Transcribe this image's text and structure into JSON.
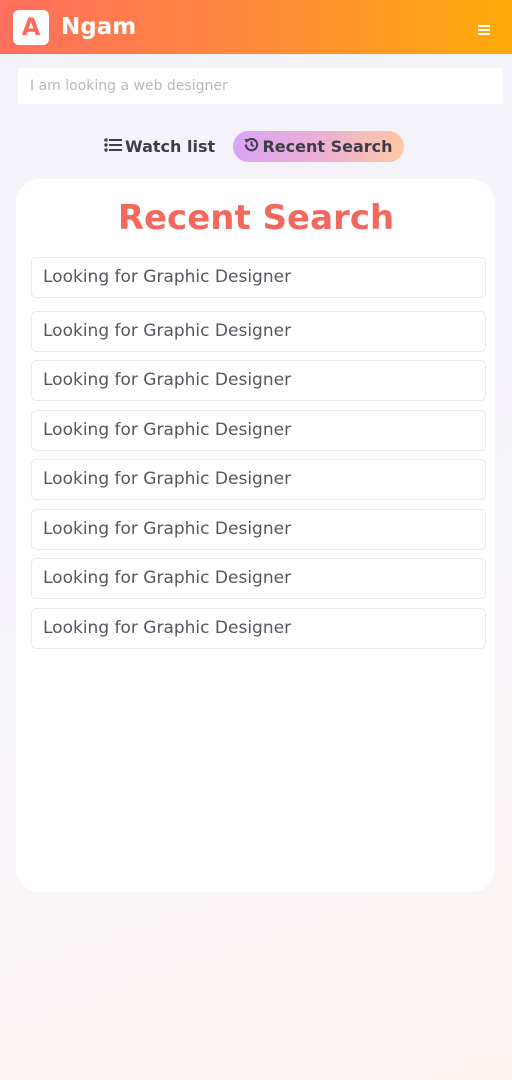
{
  "header": {
    "logo_letter": "A",
    "brand": "Ngam",
    "menu_icon": "hamburger-icon"
  },
  "search": {
    "placeholder": "I am looking a web designer",
    "value": ""
  },
  "tabs": [
    {
      "label": "Watch list",
      "icon": "list-icon",
      "active": false
    },
    {
      "label": "Recent Search",
      "icon": "history-icon",
      "active": true
    }
  ],
  "recent": {
    "title": "Recent Search",
    "items": [
      "Looking for Graphic Designer",
      "Looking for Graphic Designer",
      "Looking for Graphic Designer",
      "Looking for Graphic Designer",
      "Looking for Graphic Designer",
      "Looking for Graphic Designer",
      "Looking for Graphic Designer",
      "Looking for Graphic Designer"
    ]
  },
  "colors": {
    "header_gradient_start": "#ff6f5e",
    "header_gradient_end": "#ffab08",
    "title_color": "#f2685c",
    "active_tab_gradient_start": "#d9a3f6",
    "active_tab_gradient_end": "#ffc8a4"
  }
}
